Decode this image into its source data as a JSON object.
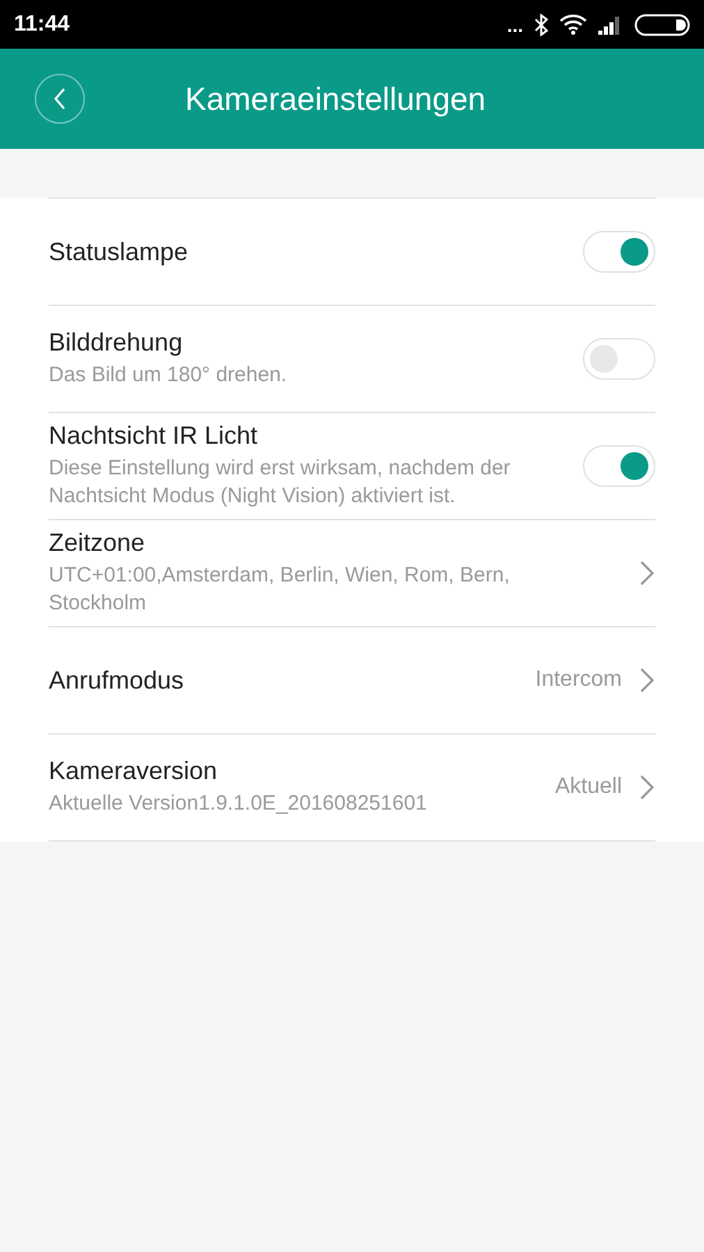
{
  "status_bar": {
    "time": "11:44",
    "dots": "..."
  },
  "header": {
    "title": "Kameraeinstellungen"
  },
  "settings": [
    {
      "kind": "toggle",
      "title": "Statuslampe",
      "on": true
    },
    {
      "kind": "toggle",
      "title": "Bilddrehung",
      "subtitle": "Das Bild um 180° drehen.",
      "on": false
    },
    {
      "kind": "toggle",
      "title": "Nachtsicht IR Licht",
      "subtitle": "Diese Einstellung wird erst wirksam, nachdem der Nachtsicht Modus (Night Vision) aktiviert ist.",
      "on": true
    },
    {
      "kind": "link",
      "title": "Zeitzone",
      "subtitle": "UTC+01:00,Amsterdam, Berlin, Wien, Rom, Bern, Stockholm"
    },
    {
      "kind": "link",
      "title": "Anrufmodus",
      "value": "Intercom"
    },
    {
      "kind": "link",
      "title": "Kameraversion",
      "subtitle": "Aktuelle Version1.9.1.0E_201608251601",
      "value": "Aktuell"
    }
  ]
}
